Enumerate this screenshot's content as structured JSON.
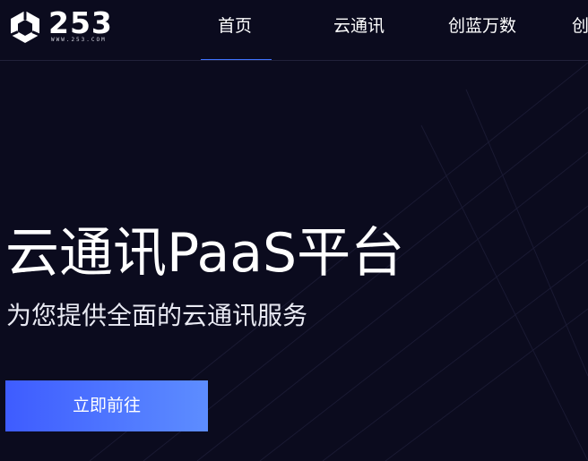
{
  "logo": {
    "digits": "253",
    "url": "WWW.253.COM",
    "icon": "cube-logo-icon"
  },
  "nav": {
    "items": [
      {
        "label": "首页",
        "active": true
      },
      {
        "label": "云通讯",
        "active": false
      },
      {
        "label": "创蓝万数",
        "active": false
      },
      {
        "label": "创",
        "active": false
      }
    ]
  },
  "hero": {
    "title": "云通讯PaaS平台",
    "subtitle": "为您提供全面的云通讯服务",
    "cta_label": "立即前往"
  },
  "colors": {
    "background": "#0b0b1e",
    "accent": "#3f73ff",
    "cta_start": "#3e5cff",
    "cta_end": "#5d8dff"
  }
}
